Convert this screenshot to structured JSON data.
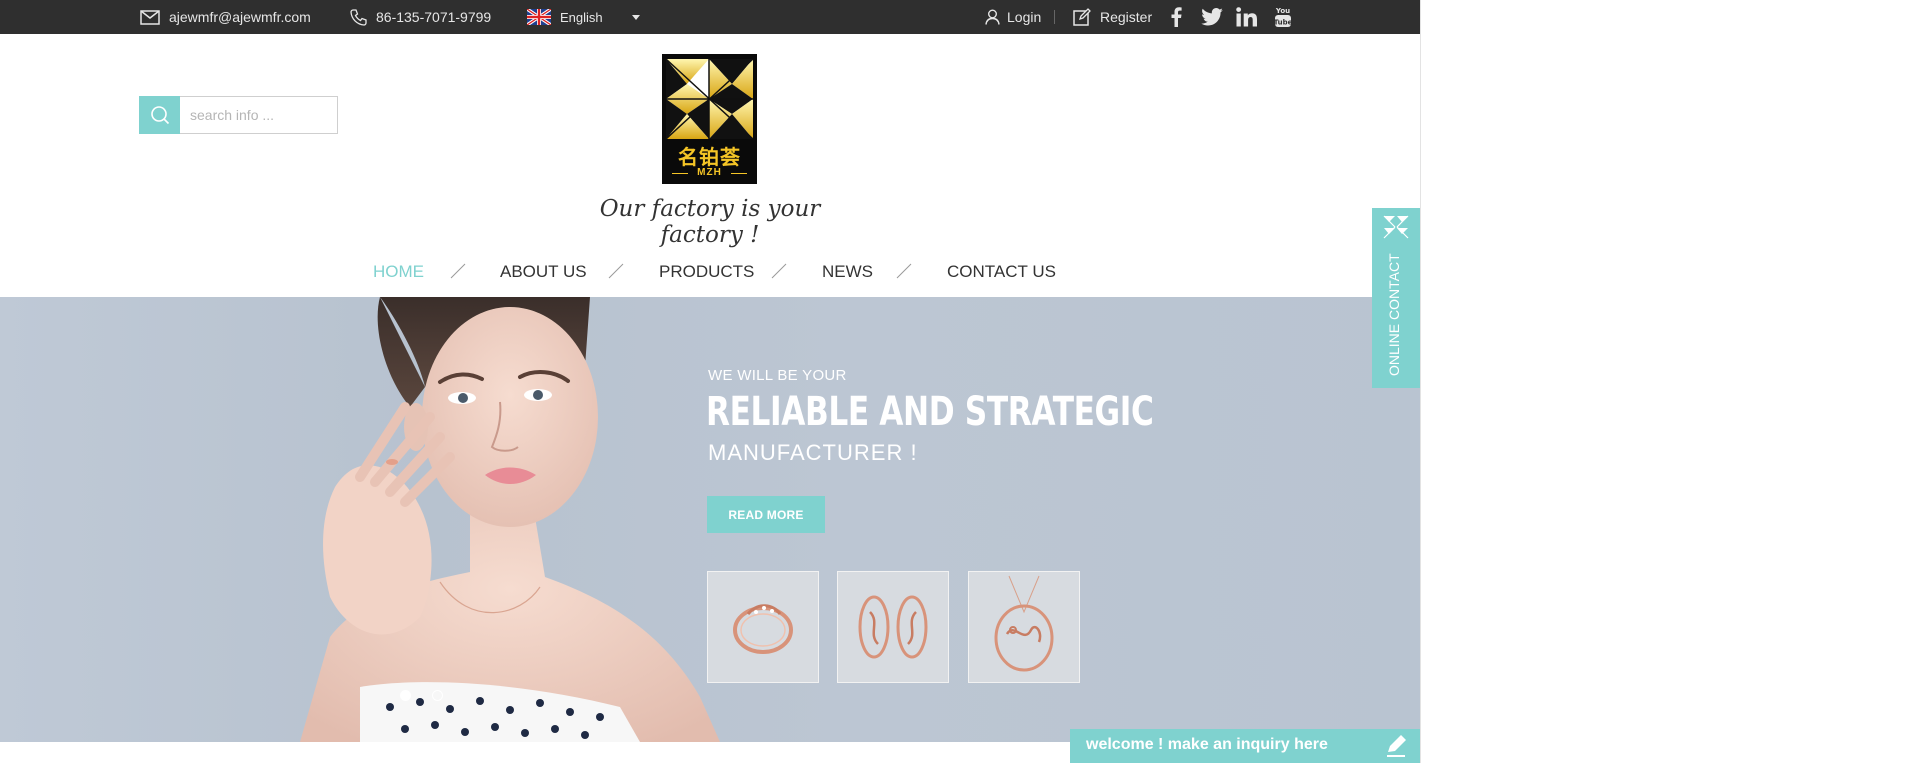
{
  "topbar": {
    "email": "ajewmfr@ajewmfr.com",
    "phone": "86-135-7071-9799",
    "language": "English",
    "login": "Login",
    "register": "Register",
    "social_icons": [
      "facebook-icon",
      "twitter-icon",
      "linkedin-icon",
      "youtube-icon"
    ]
  },
  "header": {
    "search_placeholder": "search info ...",
    "logo": {
      "chinese": "名铂荟",
      "latin": "MZH"
    },
    "tagline": "Our factory is your factory !"
  },
  "nav": {
    "items": [
      {
        "label": "HOME",
        "active": true
      },
      {
        "label": "ABOUT US",
        "active": false
      },
      {
        "label": "PRODUCTS",
        "active": false
      },
      {
        "label": "NEWS",
        "active": false
      },
      {
        "label": "CONTACT US",
        "active": false
      }
    ]
  },
  "hero": {
    "subtitle": "WE WILL BE YOUR",
    "title": "RELIABLE AND STRATEGIC",
    "title2": "MANUFACTURER !",
    "button": "READ MORE",
    "thumbnails": [
      "ring",
      "earrings",
      "necklace"
    ],
    "slides": 2,
    "active_slide": 1
  },
  "side_tab": {
    "label": "ONLINE CONTACT"
  },
  "inquiry": {
    "label": "welcome ! make an inquiry here"
  },
  "colors": {
    "accent": "#7fd2cf",
    "topbar": "#2f2f2f",
    "logo_gold": "#f5c526"
  }
}
